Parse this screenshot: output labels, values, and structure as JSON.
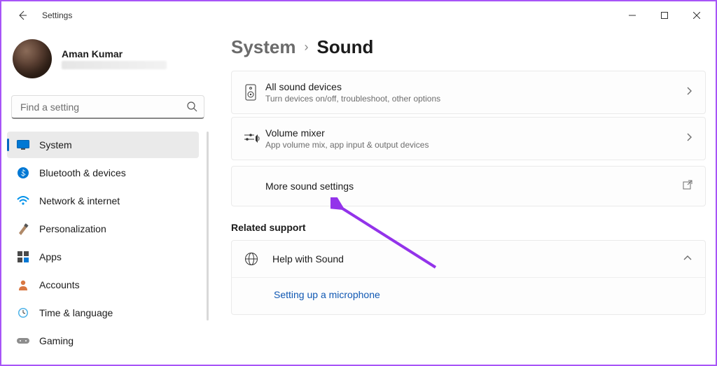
{
  "window": {
    "title": "Settings"
  },
  "user": {
    "name": "Aman Kumar"
  },
  "search": {
    "placeholder": "Find a setting"
  },
  "nav": {
    "items": [
      {
        "label": "System",
        "active": true,
        "icon": "monitor"
      },
      {
        "label": "Bluetooth & devices",
        "active": false,
        "icon": "bluetooth"
      },
      {
        "label": "Network & internet",
        "active": false,
        "icon": "wifi"
      },
      {
        "label": "Personalization",
        "active": false,
        "icon": "brush"
      },
      {
        "label": "Apps",
        "active": false,
        "icon": "apps"
      },
      {
        "label": "Accounts",
        "active": false,
        "icon": "person"
      },
      {
        "label": "Time & language",
        "active": false,
        "icon": "clock"
      },
      {
        "label": "Gaming",
        "active": false,
        "icon": "gamepad"
      }
    ]
  },
  "breadcrumb": {
    "parent": "System",
    "current": "Sound"
  },
  "cards": [
    {
      "title": "All sound devices",
      "sub": "Turn devices on/off, troubleshoot, other options",
      "icon": "speaker",
      "action": "chevron"
    },
    {
      "title": "Volume mixer",
      "sub": "App volume mix, app input & output devices",
      "icon": "mixer",
      "action": "chevron"
    },
    {
      "title": "More sound settings",
      "sub": "",
      "icon": "",
      "action": "external"
    }
  ],
  "related": {
    "label": "Related support",
    "help_title": "Help with Sound",
    "help_link": "Setting up a microphone"
  }
}
